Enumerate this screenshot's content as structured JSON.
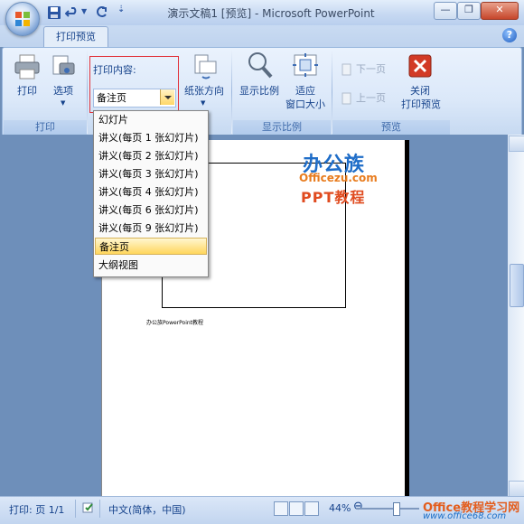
{
  "app": {
    "window_title": "演示文稿1 [预览] - Microsoft PowerPoint"
  },
  "ribbon": {
    "active_tab": "打印预览",
    "print_group": {
      "label": "打印",
      "buttons": {
        "print": "打印",
        "options": "选项"
      }
    },
    "page_setup_group": {
      "print_content_label": "打印内容:",
      "print_content_value": "备注页",
      "orientation_label": "纸张方向"
    },
    "zoom_group": {
      "label": "显示比例",
      "zoom_label": "显示比例",
      "fit_label_1": "适应",
      "fit_label_2": "窗口大小"
    },
    "preview_group": {
      "label": "预览",
      "next_page": "下一页",
      "prev_page": "上一页",
      "close_label_1": "关闭",
      "close_label_2": "打印预览"
    }
  },
  "dropdown_menu": {
    "items": [
      "幻灯片",
      "讲义(每页 1 张幻灯片)",
      "讲义(每页 2 张幻灯片)",
      "讲义(每页 3 张幻灯片)",
      "讲义(每页 4 张幻灯片)",
      "讲义(每页 6 张幻灯片)",
      "讲义(每页 9 张幻灯片)",
      "备注页",
      "大纲视图"
    ],
    "selected_index": 7
  },
  "page": {
    "note_text": "办公族PowerPoint教程"
  },
  "watermark": {
    "title": "办公族",
    "url": "Officezu.com",
    "subtitle": "PPT教程"
  },
  "statusbar": {
    "page_info": "打印: 页 1/1",
    "language": "中文(简体，中国)",
    "zoom": "44%",
    "zoom_level_fraction": 0.44
  },
  "corner_watermark": {
    "title": "Office教程学习网",
    "url": "www.office68.com"
  },
  "colors": {
    "accent_red": "#e1333b",
    "ribbon_blue": "#dbe8f9"
  }
}
